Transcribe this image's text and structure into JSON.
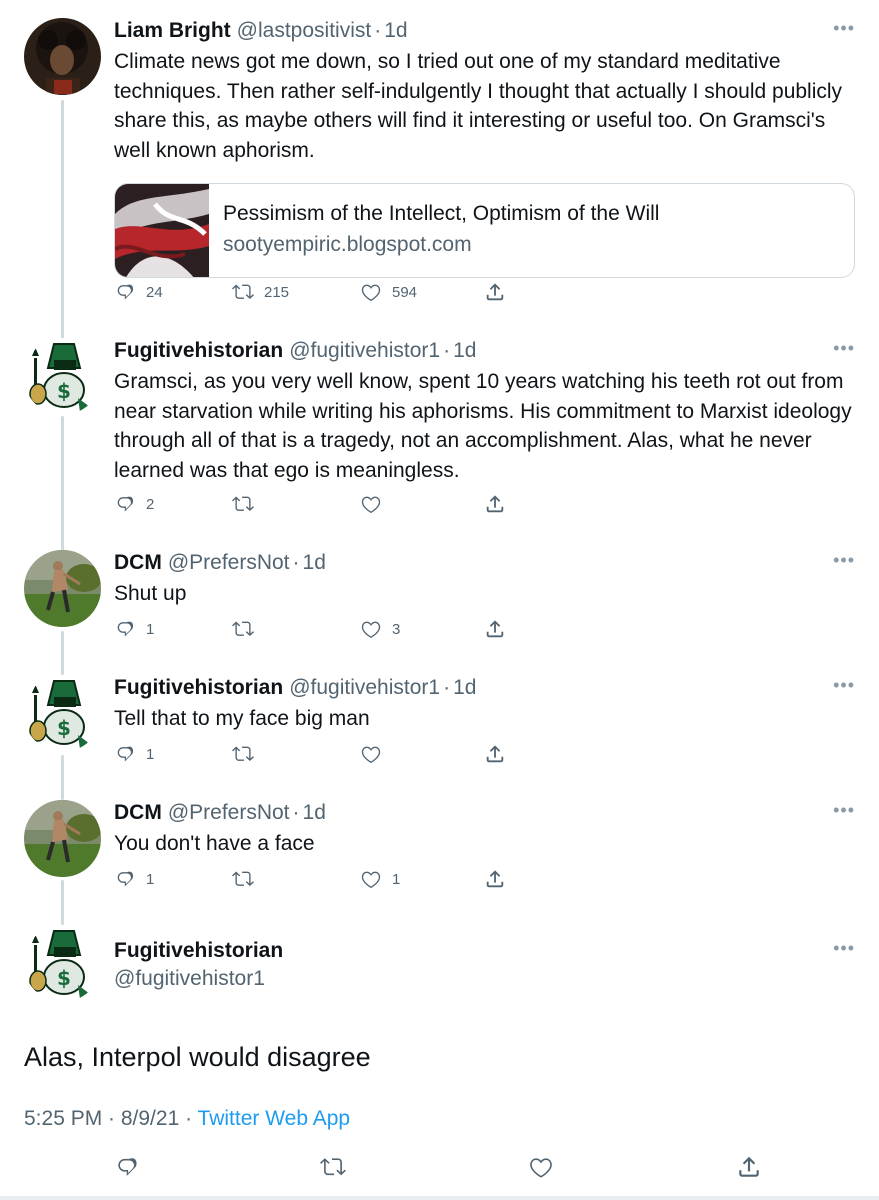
{
  "tweets": [
    {
      "name": "Liam Bright",
      "handle": "@lastpositivist",
      "time": "1d",
      "text": "Climate news got me down, so I tried out one of my standard meditative techniques. Then rather self-indulgently I thought that actually I should publicly share this, as maybe others will find it interesting or useful too. On Gramsci's well known aphorism.",
      "card": {
        "title": "Pessimism of the Intellect, Optimism of the Will",
        "domain": "sootyempiric.blogspot.com"
      },
      "replies": "24",
      "retweets": "215",
      "likes": "594"
    },
    {
      "name": "Fugitivehistorian",
      "handle": "@fugitivehistor1",
      "time": "1d",
      "text": "Gramsci, as you very well know, spent 10 years watching his teeth rot out from near starvation while writing his aphorisms. His commitment to Marxist ideology through all of that is a tragedy, not an accomplishment. Alas, what he never learned was that ego is meaningless.",
      "replies": "2",
      "retweets": "",
      "likes": ""
    },
    {
      "name": "DCM",
      "handle": "@PrefersNot",
      "time": "1d",
      "text": "Shut up",
      "replies": "1",
      "retweets": "",
      "likes": "3"
    },
    {
      "name": "Fugitivehistorian",
      "handle": "@fugitivehistor1",
      "time": "1d",
      "text": "Tell that to my face big man",
      "replies": "1",
      "retweets": "",
      "likes": ""
    },
    {
      "name": "DCM",
      "handle": "@PrefersNot",
      "time": "1d",
      "text": "You don't have a face",
      "replies": "1",
      "retweets": "",
      "likes": "1"
    }
  ],
  "main_tweet": {
    "name": "Fugitivehistorian",
    "handle": "@fugitivehistor1",
    "text": "Alas, Interpol would disagree",
    "time": "5:25 PM · 8/9/21 · ",
    "app": "Twitter Web App"
  },
  "colors": {
    "secondary_text": "#536471",
    "link": "#1d9bf0",
    "thread_line": "#cfd9de"
  },
  "icons": [
    "reply-icon",
    "retweet-icon",
    "like-icon",
    "share-icon",
    "more-icon"
  ]
}
